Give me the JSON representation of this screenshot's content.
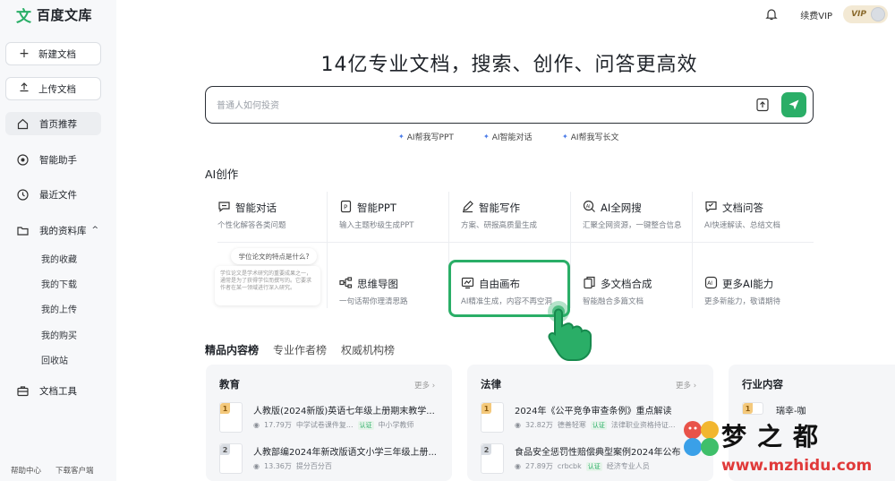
{
  "brand": {
    "logo_mark": "文",
    "name": "百度文库"
  },
  "sidebar": {
    "new_doc": "新建文档",
    "upload_doc": "上传文档",
    "nav": [
      {
        "label": "首页推荐",
        "icon": "home-icon",
        "active": true
      },
      {
        "label": "智能助手",
        "icon": "assistant-icon",
        "active": false
      },
      {
        "label": "最近文件",
        "icon": "clock-icon",
        "active": false
      },
      {
        "label": "我的资料库",
        "icon": "folder-icon",
        "active": false
      }
    ],
    "library_items": [
      "我的收藏",
      "我的下载",
      "我的上传",
      "我的购买",
      "回收站"
    ],
    "tools": "文档工具",
    "footer_help": "帮助中心",
    "footer_download": "下载客户端"
  },
  "header": {
    "renew_vip": "续费VIP",
    "vip_badge": "VIP"
  },
  "hero": {
    "headline": "14亿专业文档，搜索、创作、问答更高效",
    "search_placeholder": "普通人如何投资",
    "quick_actions": [
      "AI帮我写PPT",
      "AI智能对话",
      "AI帮我写长文"
    ]
  },
  "ai_create": {
    "title": "AI创作",
    "cards": [
      {
        "name": "智能对话",
        "desc": "个性化解答各类问题",
        "icon": "chat-icon"
      },
      {
        "name": "智能PPT",
        "desc": "输入主题秒级生成PPT",
        "icon": "ppt-icon"
      },
      {
        "name": "智能写作",
        "desc": "方案、研报高质量生成",
        "icon": "pen-icon"
      },
      {
        "name": "AI全网搜",
        "desc": "汇聚全网资源，一键整合信息",
        "icon": "search-ai-icon"
      },
      {
        "name": "文档问答",
        "desc": "AI快速解读、总结文档",
        "icon": "doc-qa-icon"
      },
      {
        "name": "思维导图",
        "desc": "一句话帮你理清思路",
        "icon": "mindmap-icon"
      },
      {
        "name": "自由画布",
        "desc": "AI精准生成，内容不再空洞",
        "icon": "canvas-icon"
      },
      {
        "name": "多文档合成",
        "desc": "智能融合多篇文档",
        "icon": "multi-doc-icon"
      },
      {
        "name": "更多AI能力",
        "desc": "更多新能力，敬请期待",
        "icon": "more-ai-icon"
      }
    ],
    "preview_bubble": "学位论文的特点是什么?",
    "preview_text": "学位论文是学术研究的重要成果之一，通常是为了获得学位而撰写的。它要求作者在某一领域进行深入研究。"
  },
  "ranking": {
    "tabs": [
      "精品内容榜",
      "专业作者榜",
      "权威机构榜"
    ],
    "panels": [
      {
        "title": "教育",
        "more": "更多 ›",
        "rows": [
          {
            "rank": "1",
            "title": "人教版(2024新版)英语七年级上册期末教学...",
            "views": "17.79万",
            "author": "中学试卷课件复...",
            "tag": "认证",
            "org": "中小学教师"
          },
          {
            "rank": "2",
            "title": "人教部编2024年新改版语文小学三年级上册...",
            "views": "13.36万",
            "author": "提分百分百",
            "tag": "",
            "org": ""
          }
        ]
      },
      {
        "title": "法律",
        "more": "更多 ›",
        "rows": [
          {
            "rank": "1",
            "title": "2024年《公平竞争审查条例》重点解读",
            "views": "32.82万",
            "author": "德善轻寒",
            "tag": "认证",
            "org": "法律职业资格持证..."
          },
          {
            "rank": "2",
            "title": "食品安全惩罚性赔偿典型案例2024年公布",
            "views": "27.89万",
            "author": "crbcbk",
            "tag": "认证",
            "org": "经济专业人员"
          }
        ]
      },
      {
        "title": "行业内容",
        "more": "",
        "rows": [
          {
            "rank": "1",
            "title": "瑞幸-咖",
            "views": "",
            "author": "",
            "tag": "",
            "org": ""
          }
        ]
      }
    ]
  },
  "watermark": {
    "text": "梦之都",
    "url": "www.mzhidu.com"
  },
  "colors": {
    "accent": "#2aae67",
    "vip_gold": "#8a6a2d",
    "watermark_red": "#e03a3a"
  }
}
